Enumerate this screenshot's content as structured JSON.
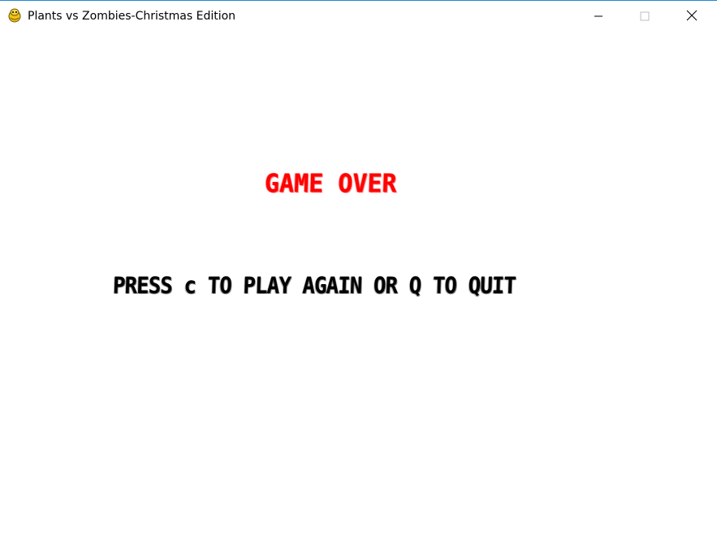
{
  "window": {
    "title": "Plants vs Zombies-Christmas Edition",
    "icon": "pygame-snake-icon",
    "controls": [
      "minimize",
      "maximize",
      "close"
    ]
  },
  "game": {
    "game_over_text": "GAME OVER",
    "instructions_text": "PRESS c TO PLAY AGAIN OR Q TO QUIT",
    "colors": {
      "background": "#ffffff",
      "game_over": "#ff0000",
      "instructions": "#000000"
    }
  }
}
